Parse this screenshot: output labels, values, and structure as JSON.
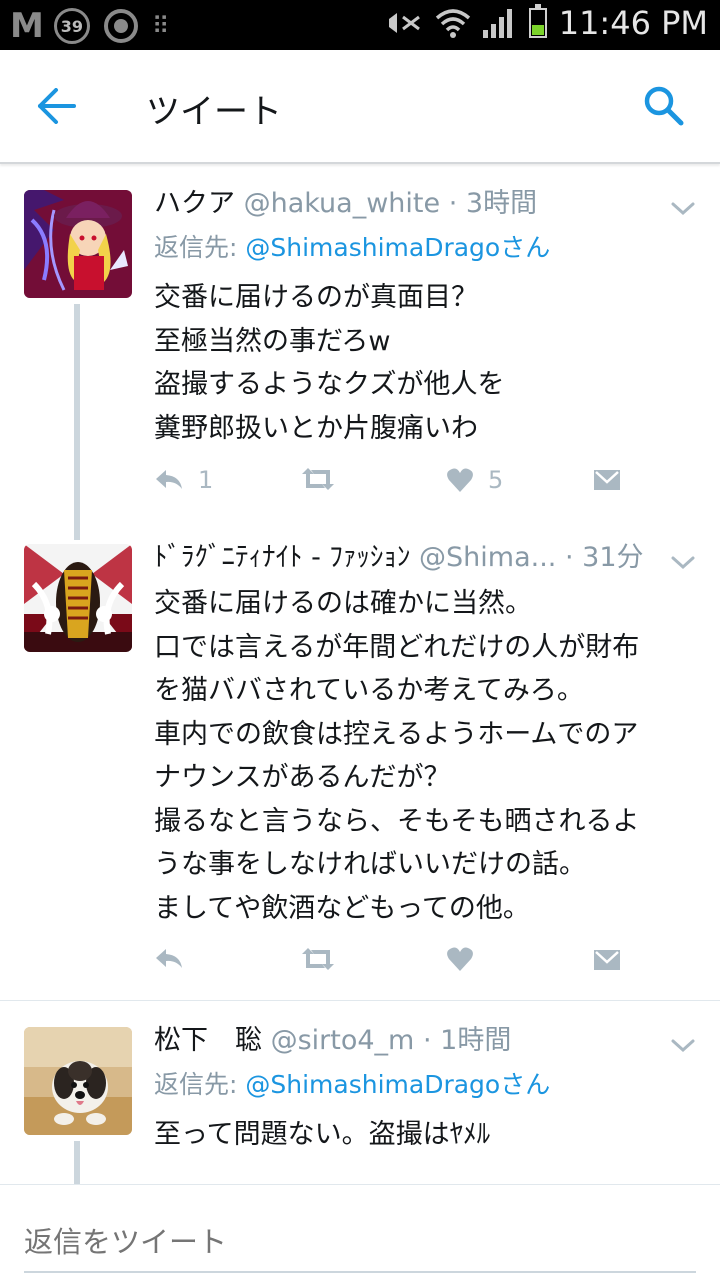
{
  "status_bar": {
    "badge_count": "39",
    "time": "11:46 PM"
  },
  "header": {
    "title": "ツイート"
  },
  "tweets": [
    {
      "display_name": "ハクア",
      "handle": "@hakua_white",
      "time": "3時間",
      "reply_label": "返信先:",
      "reply_mention": "@ShimashimaDragoさん",
      "text": "交番に届けるのが真面目？\n至極当然の事だろw\n盗撮するようなクズが他人を\n糞野郎扱いとか片腹痛いわ",
      "reply_count": "1",
      "retweet_count": "",
      "like_count": "5"
    },
    {
      "display_name": "ﾄﾞﾗｸﾞﾆﾃｨﾅｲﾄ - ﾌｧｯｼｮﾝ",
      "handle": "@Shima...",
      "time": "31分",
      "text": "交番に届けるのは確かに当然。\n口では言えるが年間どれだけの人が財布\nを猫ババされているか考えてみろ。\n車内での飲食は控えるようホームでのア\nナウンスがあるんだが？\n撮るなと言うなら、そもそも晒されるよ\nうな事をしなければいいだけの話。\nましてや飲酒などもっての他。",
      "reply_count": "",
      "retweet_count": "",
      "like_count": ""
    },
    {
      "display_name": "松下　聡",
      "handle": "@sirto4_m",
      "time": "1時間",
      "reply_label": "返信先:",
      "reply_mention": "@ShimashimaDragoさん",
      "text": "至って問題ない。盗撮はﾔﾒﾙ"
    }
  ],
  "compose": {
    "placeholder": "返信をツイート"
  },
  "colors": {
    "accent": "#1b95e0",
    "secondary_text": "#8899a6",
    "action_icon": "#aab8c2",
    "thread_line": "#ccd6dd"
  }
}
